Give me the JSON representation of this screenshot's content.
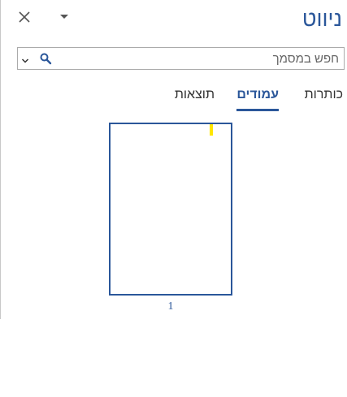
{
  "pane": {
    "title": "ניווט",
    "accent_color": "#2b579a",
    "highlight_color": "#ffe600"
  },
  "header": {
    "dropdown_icon": "caret-down-icon",
    "close_icon": "close-icon"
  },
  "search": {
    "placeholder": "חפש במסמך",
    "value": "",
    "icon": "search-icon",
    "options_icon": "chevron-down-icon"
  },
  "tabs": [
    {
      "label": "כותרות",
      "active": false
    },
    {
      "label": "עמודים",
      "active": true
    },
    {
      "label": "תוצאות",
      "active": false
    }
  ],
  "pages": [
    {
      "number": "1",
      "selected": true
    }
  ]
}
